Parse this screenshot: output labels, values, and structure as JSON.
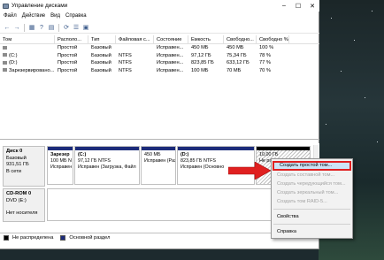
{
  "window": {
    "title": "Управление дисками",
    "controls": {
      "minimize": "–",
      "maximize": "☐",
      "close": "✕"
    }
  },
  "menu": [
    "Файл",
    "Действие",
    "Вид",
    "Справка"
  ],
  "toolbar": {
    "icons": [
      "back-arrow-icon",
      "forward-arrow-icon",
      "grid-view-icon",
      "help-icon",
      "properties-icon",
      "refresh-icon",
      "list-icon",
      "export-icon"
    ]
  },
  "volume_table": {
    "headers": [
      "Том",
      "Располо...",
      "Тип",
      "Файловая с...",
      "Состояние",
      "Емкость",
      "Свободно...",
      "Свободно %"
    ],
    "rows": [
      [
        "",
        "Простой",
        "Базовый",
        "",
        "Исправен...",
        "450 МБ",
        "450 МБ",
        "100 %"
      ],
      [
        "(C:)",
        "Простой",
        "Базовый",
        "NTFS",
        "Исправен...",
        "97,12 ГБ",
        "75,34 ГБ",
        "78 %"
      ],
      [
        "(D:)",
        "Простой",
        "Базовый",
        "NTFS",
        "Исправен...",
        "823,85 ГБ",
        "633,12 ГБ",
        "77 %"
      ],
      [
        "Зарезервировано...",
        "Простой",
        "Базовый",
        "NTFS",
        "Исправен...",
        "100 МБ",
        "70 МБ",
        "70 %"
      ]
    ]
  },
  "disks": [
    {
      "label": "Диск 0",
      "type": "Базовый",
      "size": "931,51 ГБ",
      "status": "В сети",
      "partitions": [
        {
          "name": "Зарезер",
          "line2": "100 МБ N",
          "line3": "Исправен"
        },
        {
          "name": "(C:)",
          "line2": "97,12 ГБ NTFS",
          "line3": "Исправен (Загрузка, Файл"
        },
        {
          "name": "",
          "line2": "450 МБ",
          "line3": "Исправен (Раздел"
        },
        {
          "name": "(D:)",
          "line2": "823,85 ГБ NTFS",
          "line3": "Исправен (Основно"
        },
        {
          "name": "",
          "line2": "10,00 ГБ",
          "line3": "Не распр"
        }
      ]
    },
    {
      "label": "CD-ROM 0",
      "type": "DVD (E:)",
      "size": "",
      "status": "Нет носителя"
    }
  ],
  "legend": [
    {
      "label": "Не распределена",
      "color": "#000000"
    },
    {
      "label": "Основной раздел",
      "color": "#1c2b7a"
    }
  ],
  "context_menu": {
    "items": [
      {
        "label": "Создать простой том...",
        "enabled": true,
        "highlighted": true
      },
      {
        "label": "Создать составной том...",
        "enabled": false
      },
      {
        "label": "Создать чередующийся том...",
        "enabled": false
      },
      {
        "label": "Создать зеркальный том...",
        "enabled": false
      },
      {
        "label": "Создать том RAID-5...",
        "enabled": false
      },
      {
        "separator": true
      },
      {
        "label": "Свойства",
        "enabled": true
      },
      {
        "separator": true
      },
      {
        "label": "Справка",
        "enabled": true
      }
    ]
  },
  "colors": {
    "primary_partition": "#1c2b7a",
    "unallocated": "#000000",
    "highlight_border": "#e02020",
    "arrow": "#e02020"
  }
}
